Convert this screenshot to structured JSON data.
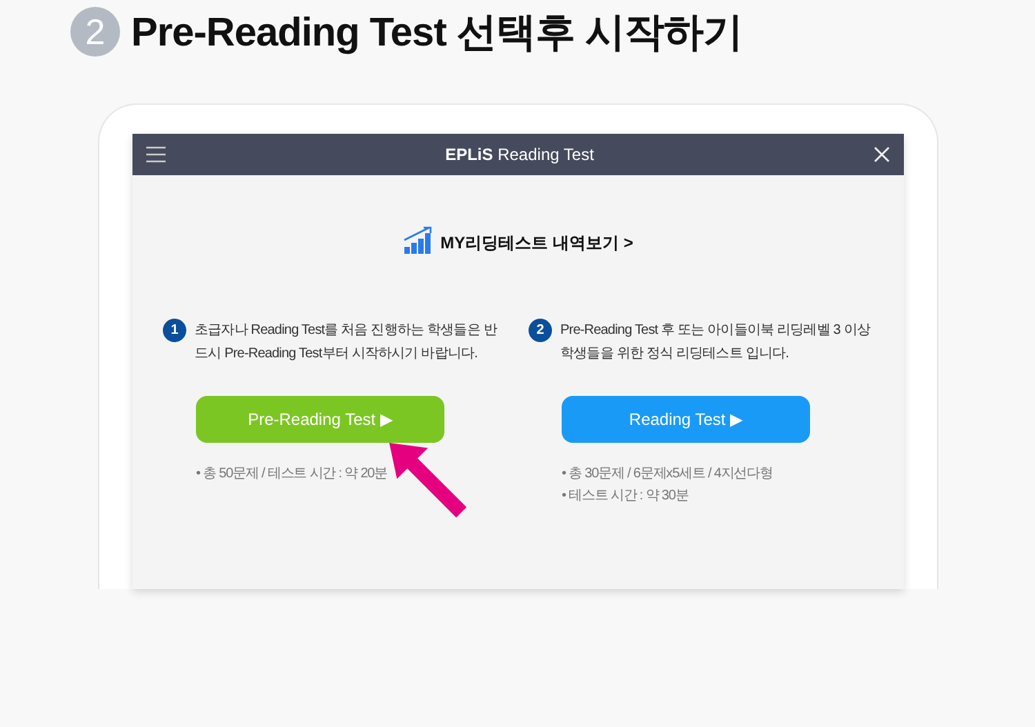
{
  "step": {
    "number": "2",
    "title": "Pre-Reading Test 선택후 시작하기"
  },
  "window": {
    "title": "**EPLiS** Reading Test"
  },
  "history_link": "MY리딩테스트 내역보기 >",
  "tests": [
    {
      "number": "1",
      "description": "초급자나 Reading Test를 처음 진행하는 학생들은 반드시 Pre-Reading Test부터 시작하시기 바랍니다.",
      "button": "Pre-Reading Test ▶",
      "color": "#7cc623",
      "highlighted": true,
      "notes": [
        "• 총 50문제 / 테스트 시간 : 약 20분"
      ]
    },
    {
      "number": "2",
      "description": "Pre-Reading Test 후 또는 아이들이북 리딩레벨 3 이상 학생들을 위한 정식 리딩테스트 입니다.",
      "button": "Reading Test ▶",
      "color": "#1a9af7",
      "highlighted": false,
      "notes": [
        "• 총 30문제 / 6문제x5세트 / 4지선다형",
        "• 테스트 시간 : 약 30분"
      ]
    }
  ]
}
